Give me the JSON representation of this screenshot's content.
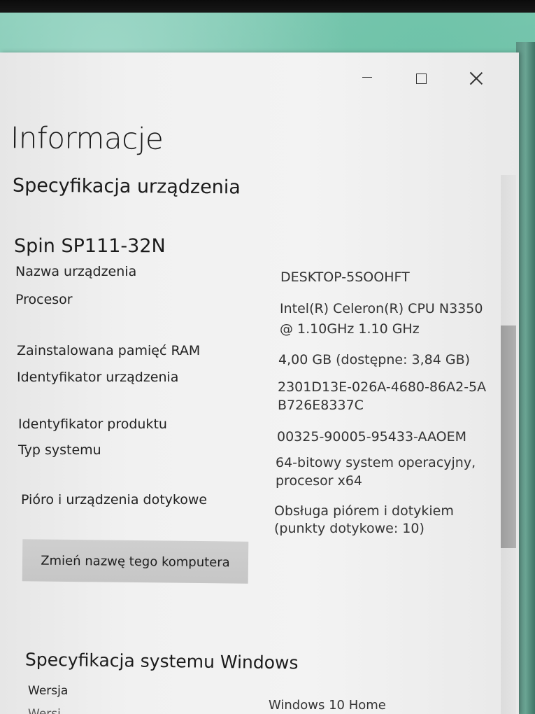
{
  "window": {
    "title": "Informacje",
    "controls": {
      "minimize_icon": "minimize-icon",
      "maximize_icon": "maximize-icon",
      "close_icon": "close-icon"
    }
  },
  "device_spec": {
    "heading": "Specyfikacja urządzenia",
    "model": "Spin SP111-32N",
    "items": [
      {
        "label": "Nazwa urządzenia",
        "value": [
          "DESKTOP-5SOOHFT"
        ]
      },
      {
        "label": "Procesor",
        "value": [
          "Intel(R) Celeron(R) CPU N3350",
          "@ 1.10GHz   1.10 GHz"
        ]
      },
      {
        "label": "Zainstalowana pamięć RAM",
        "value": [
          "4,00 GB (dostępne: 3,84 GB)"
        ]
      },
      {
        "label": "Identyfikator urządzenia",
        "value": [
          "2301D13E-026A-4680-86A2-5A",
          "B726E8337C"
        ]
      },
      {
        "label": "Identyfikator produktu",
        "value": [
          "00325-90005-95433-AAOEM"
        ]
      },
      {
        "label": "Typ systemu",
        "value": [
          "64-bitowy system operacyjny,",
          "procesor x64"
        ]
      },
      {
        "label": "Pióro i urządzenia dotykowe",
        "value": [
          "Obsługa piórem i dotykiem",
          "(punkty dotykowe: 10)"
        ]
      }
    ],
    "rename_button": "Zmień nazwę tego komputera"
  },
  "windows_spec": {
    "heading": "Specyfikacja systemu Windows",
    "items": [
      {
        "label": "Wersja",
        "value": "Windows 10 Home"
      }
    ],
    "cutoff_label": "Wersj"
  }
}
